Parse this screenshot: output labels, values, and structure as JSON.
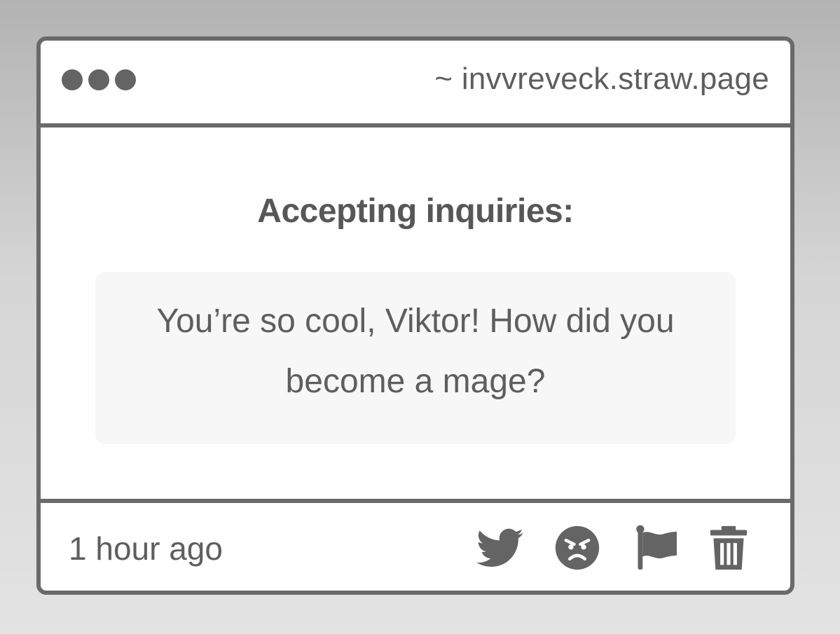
{
  "window": {
    "url": "~ invvreveck.straw.page"
  },
  "content": {
    "heading": "Accepting inquiries:",
    "question": "You’re so cool, Viktor! How did you become a mage?"
  },
  "footer": {
    "timestamp": "1 hour ago",
    "actions": [
      {
        "icon": "twitter-icon"
      },
      {
        "icon": "angry-face-icon"
      },
      {
        "icon": "flag-icon"
      },
      {
        "icon": "trash-icon"
      }
    ]
  },
  "colors": {
    "frame": "#6a6a6a",
    "text": "#5e5e5e",
    "question_bg": "#f7f7f7"
  }
}
